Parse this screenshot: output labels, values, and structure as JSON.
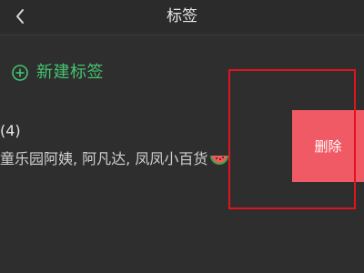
{
  "header": {
    "title": "标签",
    "back_icon": "chevron-left-icon"
  },
  "actions": {
    "new_tag_label": "新建标签",
    "new_tag_icon": "circle-plus-icon"
  },
  "tag": {
    "count": "(4)",
    "members": "童乐园阿姨, 阿凡达, 凤凤小百货",
    "emoji_icon": "watermelon-icon"
  },
  "swipe_action": {
    "delete_label": "删除"
  },
  "colors": {
    "accent_green": "#45c46f",
    "delete_red": "#f05a64",
    "highlight_red": "#e0141c",
    "background": "#2e2e2e"
  }
}
